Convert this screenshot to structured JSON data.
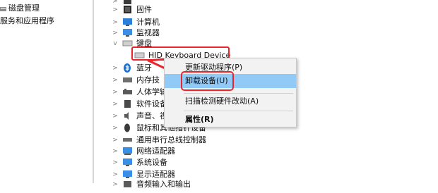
{
  "left_pane": {
    "items": [
      {
        "label": "磁盘管理",
        "icon": "disk-management-icon"
      },
      {
        "label": "服务和应用程序",
        "icon": "services-apps-icon"
      }
    ]
  },
  "tree": {
    "items": [
      {
        "label": "",
        "icon": "device-icon",
        "expanded": false
      },
      {
        "label": "固件",
        "icon": "firmware-icon",
        "expanded": false
      },
      {
        "label": "计算机",
        "icon": "computer-icon",
        "expanded": false
      },
      {
        "label": "监视器",
        "icon": "monitor-icon",
        "expanded": false
      },
      {
        "label": "键盘",
        "icon": "keyboard-icon",
        "expanded": true
      },
      {
        "label": "蓝牙",
        "icon": "bluetooth-icon",
        "expanded": false
      },
      {
        "label": "内存技",
        "icon": "memory-tech-icon",
        "expanded": false
      },
      {
        "label": "人体学输",
        "icon": "hid-icon",
        "expanded": false
      },
      {
        "label": "软件设备",
        "icon": "software-device-icon",
        "expanded": false
      },
      {
        "label": "声音、视",
        "icon": "sound-icon",
        "expanded": false
      },
      {
        "label": "鼠标和其他指针设备",
        "icon": "mouse-icon",
        "expanded": false
      },
      {
        "label": "通用串行总线控制器",
        "icon": "usb-icon",
        "expanded": false
      },
      {
        "label": "网络适配器",
        "icon": "network-adapter-icon",
        "expanded": false
      },
      {
        "label": "系统设备",
        "icon": "system-device-icon",
        "expanded": false
      },
      {
        "label": "显示适配器",
        "icon": "display-adapter-icon",
        "expanded": false
      },
      {
        "label": "音频输入和输出",
        "icon": "audio-io-icon",
        "expanded": false
      }
    ],
    "hid_device": {
      "label": "HID Keyboard Device",
      "icon": "keyboard-icon"
    }
  },
  "context_menu": {
    "items": [
      {
        "label": "更新驱动程序(P)"
      },
      {
        "label": "卸载设备(U)",
        "selected": true
      },
      {
        "label": "扫描检测硬件改动(A)"
      },
      {
        "label": "属性(R)",
        "bold": true
      }
    ]
  },
  "colors": {
    "highlight_red": "#e8262b",
    "selection_blue": "#91c9f7",
    "menu_bg": "#f2f2f2"
  }
}
